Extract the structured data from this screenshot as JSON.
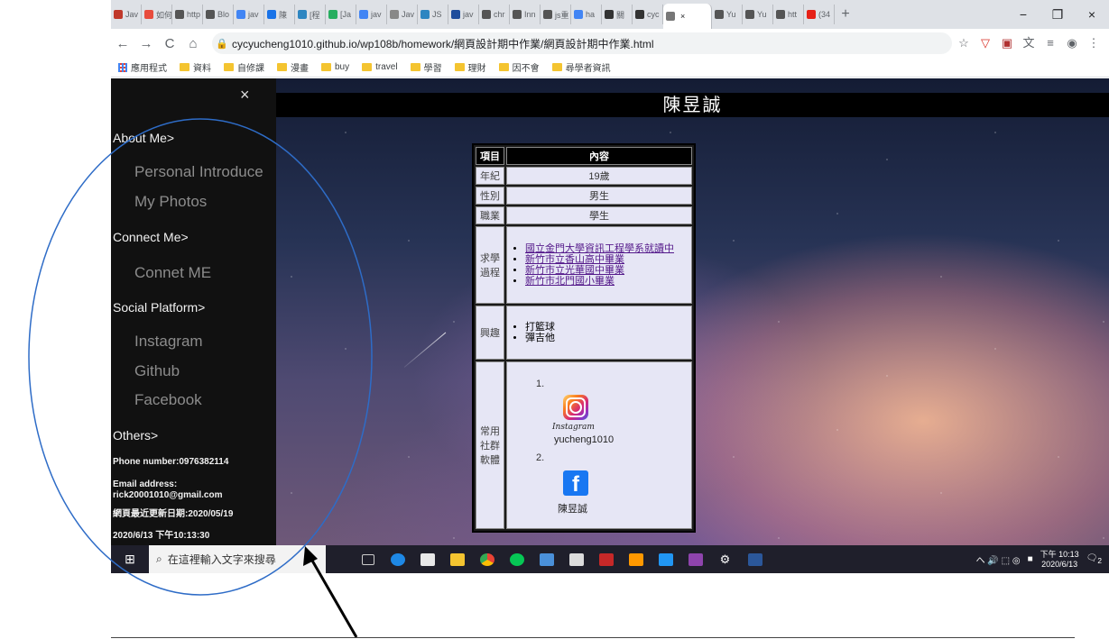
{
  "browser": {
    "tabs": [
      {
        "label": "Jav",
        "color": "#c0392b"
      },
      {
        "label": "如何",
        "color": "#e84c3d"
      },
      {
        "label": "http",
        "color": "#555555"
      },
      {
        "label": "Blo",
        "color": "#555555"
      },
      {
        "label": "jav",
        "color": "#4285f4"
      },
      {
        "label": "陳",
        "color": "#1a73e8"
      },
      {
        "label": "[程",
        "color": "#2e86c1"
      },
      {
        "label": "[Ja",
        "color": "#27ae60"
      },
      {
        "label": "jav",
        "color": "#4285f4"
      },
      {
        "label": "Jav",
        "color": "#888888"
      },
      {
        "label": "JS",
        "color": "#2e86c1"
      },
      {
        "label": "jav",
        "color": "#1f4e9c"
      },
      {
        "label": "chr",
        "color": "#555555"
      },
      {
        "label": "Inn",
        "color": "#555555"
      },
      {
        "label": "js重",
        "color": "#555555"
      },
      {
        "label": "ha",
        "color": "#4285f4"
      },
      {
        "label": "關",
        "color": "#333333"
      },
      {
        "label": "cyc",
        "color": "#333333"
      },
      {
        "label": "",
        "color": "#777777",
        "active": true
      },
      {
        "label": "Yu",
        "color": "#555555"
      },
      {
        "label": "Yu",
        "color": "#555555"
      },
      {
        "label": "htt",
        "color": "#555555"
      },
      {
        "label": "(34",
        "color": "#e62117"
      }
    ],
    "new_tab": "+",
    "window_controls": {
      "minimize": "−",
      "maximize": "❐",
      "close": "×"
    },
    "nav": {
      "back": "←",
      "forward": "→",
      "reload": "C",
      "home": "⌂"
    },
    "url": "cycyucheng1010.github.io/wp108b/homework/網頁設計期中作業/網頁設計期中作業.html",
    "bookmarks": [
      "應用程式",
      "資料",
      "自修課",
      "漫畫",
      "buy",
      "travel",
      "學習",
      "理財",
      "因不會",
      "尋學者資訊"
    ]
  },
  "page": {
    "title": "陳昱誠",
    "sidebar": {
      "close": "×",
      "about_heading": "About Me>",
      "about_links": [
        "Personal Introduce",
        "My Photos"
      ],
      "connect_heading": "Connect Me>",
      "connect_links": [
        "Connet ME"
      ],
      "social_heading": "Social Platform>",
      "social_links": [
        "Instagram",
        "Github",
        "Facebook"
      ],
      "others_heading": "Others>",
      "phone": "Phone number:0976382114",
      "email_label": "Email address:",
      "email": "rick20001010@gmail.com",
      "updated": "網頁最近更新日期:2020/05/19",
      "now": "2020/6/13 下午10:13:30"
    },
    "table": {
      "headers": [
        "項目",
        "內容"
      ],
      "rows": [
        {
          "label": "年紀",
          "value": "19歲"
        },
        {
          "label": "性別",
          "value": "男生"
        },
        {
          "label": "職業",
          "value": "學生"
        }
      ],
      "education_label": "求學\n過程",
      "education": [
        "國立金門大學資訊工程學系就讀中",
        "新竹市立香山高中畢業",
        "新竹市立光華國中畢業",
        "新竹市北門國小畢業"
      ],
      "hobby_label": "興趣",
      "hobbies": [
        "打籃球",
        "彈吉他"
      ],
      "social_label": "常用\n社群\n軟體",
      "social": [
        {
          "num": "1.",
          "brand": "Instagram",
          "account": "yucheng1010"
        },
        {
          "num": "2.",
          "brand": "f",
          "account": "陳昱誠"
        }
      ]
    }
  },
  "taskbar": {
    "search_placeholder": "在這裡輸入文字來搜尋",
    "tray_icons": "へ 🔊 ⬚ ◎",
    "time": "下午 10:13",
    "date": "2020/6/13",
    "notify_count": "2"
  }
}
